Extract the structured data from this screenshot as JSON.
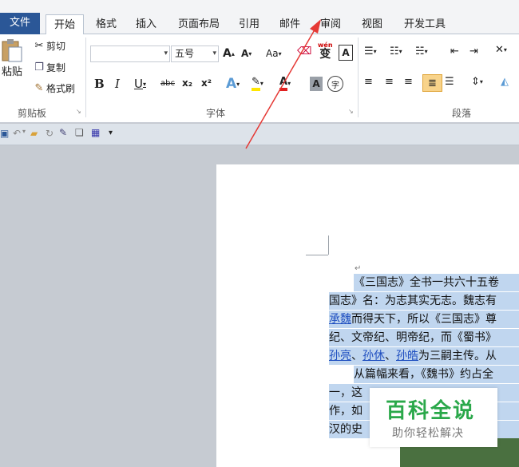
{
  "tabs": [
    "文件",
    "开始",
    "格式",
    "插入",
    "页面布局",
    "引用",
    "邮件",
    "审阅",
    "视图",
    "开发工具"
  ],
  "clipboard": {
    "paste": "粘贴",
    "cut": "剪切",
    "copy": "复制",
    "format_painter": "格式刷",
    "label": "剪贴板"
  },
  "font": {
    "size": "五号",
    "label": "字体",
    "bold": "B",
    "italic": "I",
    "underline": "U",
    "strike": "abc",
    "subscript": "x₂",
    "superscript": "x²",
    "grow": "A",
    "shrink": "A",
    "case": "Aa",
    "phonetic": "wén",
    "phonetic_char": "变",
    "border_char": "A",
    "shade_char": "A",
    "enclose_char": "字"
  },
  "paragraph": {
    "label": "段落"
  },
  "document": {
    "lines": [
      "《三国志》全书一共六十五卷",
      "国志》名：为志其实无志。魏志有",
      "承魏而得天下，所以《三国志》尊",
      "纪、文帝纪、明帝纪，而《蜀书》",
      "孙亮、孙休、孙皓为三嗣主传。从",
      "从篇幅来看，《魏书》约占全",
      "一，这",
      "作，如",
      "汉的史"
    ],
    "line3_links": [
      "承魏"
    ],
    "line5_links": [
      "孙亮",
      "孙休",
      "孙皓"
    ]
  },
  "watermark": {
    "title": "百科全说",
    "subtitle": "助你轻松解决"
  }
}
